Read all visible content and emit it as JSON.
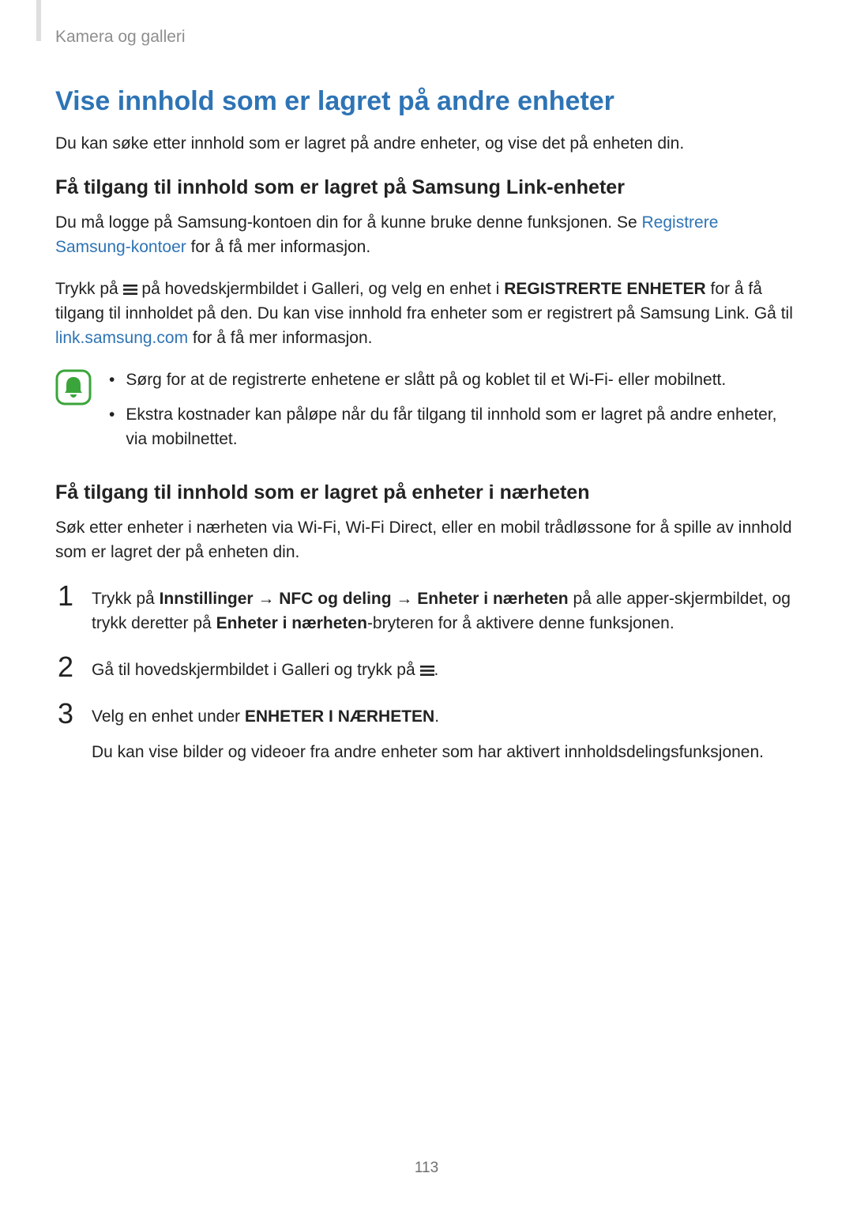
{
  "header": {
    "section": "Kamera og galleri"
  },
  "main_heading": "Vise innhold som er lagret på andre enheter",
  "intro": "Du kan søke etter innhold som er lagret på andre enheter, og vise det på enheten din.",
  "sec1": {
    "heading": "Få tilgang til innhold som er lagret på Samsung Link-enheter",
    "p1_a": "Du må logge på Samsung-kontoen din for å kunne bruke denne funksjonen. Se ",
    "p1_link1": "Registrere Samsung-kontoer",
    "p1_b": " for å få mer informasjon.",
    "p2_a": "Trykk på ",
    "p2_b": " på hovedskjermbildet i Galleri, og velg en enhet i ",
    "p2_bold": "REGISTRERTE ENHETER",
    "p2_c": " for å få tilgang til innholdet på den. Du kan vise innhold fra enheter som er registrert på Samsung Link. Gå til ",
    "p2_link": "link.samsung.com",
    "p2_d": " for å få mer informasjon.",
    "bullets": [
      "Sørg for at de registrerte enhetene er slått på og koblet til et Wi-Fi- eller mobilnett.",
      "Ekstra kostnader kan påløpe når du får tilgang til innhold som er lagret på andre enheter, via mobilnettet."
    ]
  },
  "sec2": {
    "heading": "Få tilgang til innhold som er lagret på enheter i nærheten",
    "intro": "Søk etter enheter i nærheten via Wi-Fi, Wi-Fi Direct, eller en mobil trådløssone for å spille av innhold som er lagret der på enheten din.",
    "steps": {
      "s1": {
        "num": "1",
        "a": "Trykk på ",
        "b1": "Innstillinger",
        "arrow1": " → ",
        "b2": "NFC og deling",
        "arrow2": " → ",
        "b3": "Enheter i nærheten",
        "c": " på alle apper-skjermbildet, og trykk deretter på ",
        "b4": "Enheter i nærheten",
        "d": "-bryteren for å aktivere denne funksjonen."
      },
      "s2": {
        "num": "2",
        "a": "Gå til hovedskjermbildet i Galleri og trykk på ",
        "b": "."
      },
      "s3": {
        "num": "3",
        "a": "Velg en enhet under ",
        "b": "ENHETER I NÆRHETEN",
        "c": ".",
        "sub": "Du kan vise bilder og videoer fra andre enheter som har aktivert innholdsdelingsfunksjonen."
      }
    }
  },
  "page_number": "113"
}
